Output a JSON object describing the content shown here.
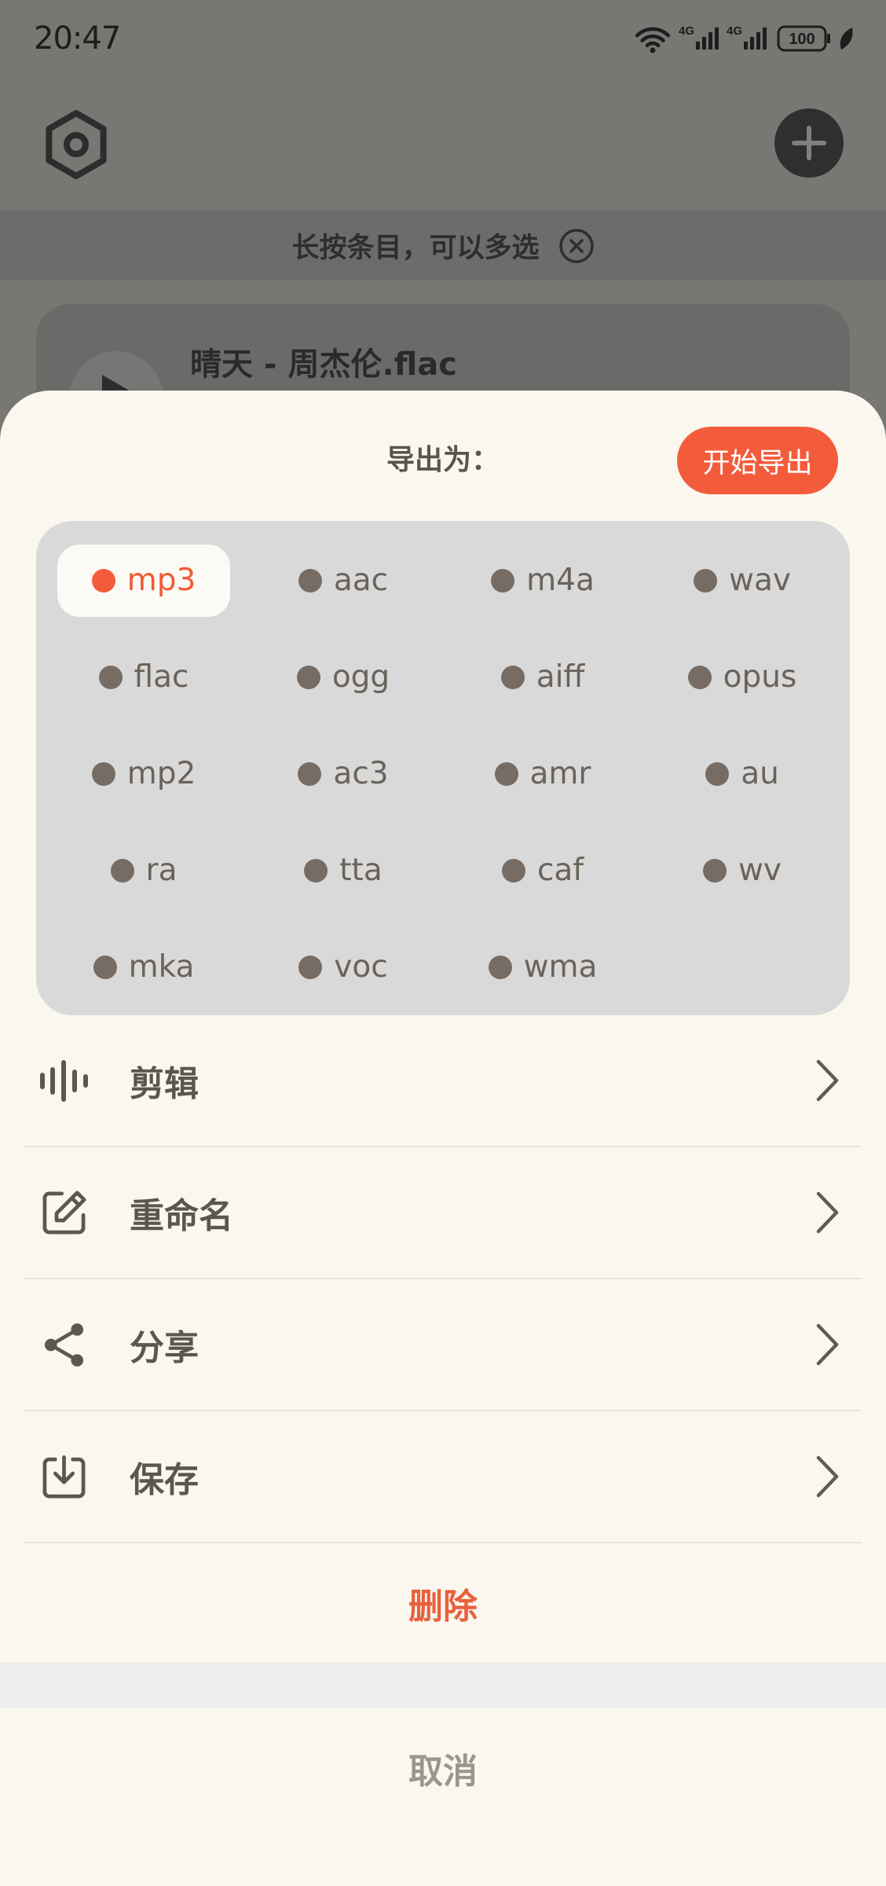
{
  "status_bar": {
    "time": "20:47",
    "network_1": "4G",
    "network_2": "4G",
    "battery": "100",
    "icons": [
      "wifi-icon",
      "signal-icon",
      "signal-icon",
      "battery-icon",
      "leaf-icon"
    ]
  },
  "app": {
    "top_bar": {
      "left_icon": "settings-hexagon-icon",
      "right_icon": "plus-icon"
    },
    "hint_banner": {
      "text": "长按条目，可以多选",
      "icon": "close-circle-icon"
    },
    "file_list": [
      {
        "title": "晴天 - 周杰伦.flac",
        "icon": "play-icon"
      }
    ]
  },
  "export_sheet": {
    "title": "导出为：",
    "start_button": "开始导出",
    "formats": [
      {
        "label": "mp3",
        "selected": true
      },
      {
        "label": "aac",
        "selected": false
      },
      {
        "label": "m4a",
        "selected": false
      },
      {
        "label": "wav",
        "selected": false
      },
      {
        "label": "flac",
        "selected": false
      },
      {
        "label": "ogg",
        "selected": false
      },
      {
        "label": "aiff",
        "selected": false
      },
      {
        "label": "opus",
        "selected": false
      },
      {
        "label": "mp2",
        "selected": false
      },
      {
        "label": "ac3",
        "selected": false
      },
      {
        "label": "amr",
        "selected": false
      },
      {
        "label": "au",
        "selected": false
      },
      {
        "label": "ra",
        "selected": false
      },
      {
        "label": "tta",
        "selected": false
      },
      {
        "label": "caf",
        "selected": false
      },
      {
        "label": "wv",
        "selected": false
      },
      {
        "label": "mka",
        "selected": false
      },
      {
        "label": "voc",
        "selected": false
      },
      {
        "label": "wma",
        "selected": false
      }
    ],
    "actions": [
      {
        "label": "剪辑",
        "icon": "waveform-icon"
      },
      {
        "label": "重命名",
        "icon": "edit-icon"
      },
      {
        "label": "分享",
        "icon": "share-icon"
      },
      {
        "label": "保存",
        "icon": "download-icon"
      }
    ],
    "delete_label": "删除",
    "cancel_label": "取消"
  },
  "colors": {
    "accent": "#f35c3b",
    "delete_text": "#e8603c",
    "sheet_background": "#faf7ef",
    "format_panel": "#d9d9d9",
    "primary_text": "#5d564e",
    "muted_text": "#9b958f"
  }
}
